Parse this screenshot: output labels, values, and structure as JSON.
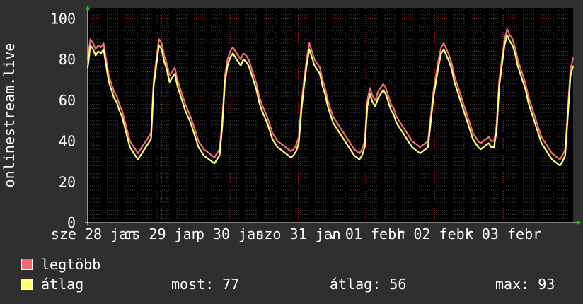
{
  "chart_data": {
    "type": "line",
    "ylabel": "onlinestream.live",
    "ylim": [
      0,
      105
    ],
    "yticks": [
      0,
      20,
      40,
      60,
      80,
      100
    ],
    "grid": true,
    "xtick_labels": [
      "sze 28 jan",
      "cs 29 jan",
      "p 30 jan",
      "szo 31 jan",
      "v 01 febr",
      "h 02 febr",
      "k 03 febr"
    ],
    "series": [
      {
        "name": "legtöbb",
        "color": "#f06a78",
        "values": [
          80,
          90,
          88,
          85,
          87,
          86,
          88,
          80,
          72,
          68,
          64,
          62,
          58,
          55,
          50,
          45,
          40,
          38,
          36,
          34,
          36,
          38,
          40,
          42,
          44,
          70,
          80,
          90,
          88,
          82,
          78,
          72,
          74,
          76,
          70,
          66,
          62,
          58,
          55,
          52,
          48,
          44,
          40,
          38,
          36,
          35,
          34,
          33,
          32,
          34,
          36,
          50,
          72,
          80,
          84,
          86,
          84,
          82,
          80,
          83,
          82,
          80,
          76,
          72,
          68,
          62,
          58,
          55,
          52,
          48,
          44,
          42,
          40,
          39,
          38,
          37,
          36,
          35,
          36,
          38,
          42,
          58,
          70,
          80,
          88,
          84,
          80,
          78,
          76,
          70,
          66,
          60,
          56,
          52,
          50,
          48,
          46,
          44,
          42,
          40,
          38,
          36,
          35,
          34,
          36,
          40,
          60,
          66,
          62,
          60,
          64,
          66,
          68,
          66,
          62,
          58,
          56,
          52,
          50,
          48,
          46,
          44,
          42,
          40,
          39,
          38,
          37,
          38,
          39,
          40,
          52,
          64,
          72,
          80,
          86,
          88,
          85,
          82,
          78,
          72,
          68,
          64,
          60,
          56,
          52,
          48,
          44,
          42,
          40,
          39,
          40,
          41,
          42,
          40,
          40,
          48,
          70,
          80,
          90,
          95,
          92,
          90,
          86,
          80,
          76,
          72,
          68,
          62,
          58,
          54,
          50,
          46,
          42,
          40,
          38,
          36,
          34,
          33,
          32,
          31,
          33,
          36,
          55,
          75,
          81
        ]
      },
      {
        "name": "átlag",
        "color": "#ffff70",
        "values": [
          76,
          87,
          85,
          82,
          84,
          83,
          85,
          77,
          69,
          65,
          61,
          59,
          55,
          52,
          47,
          42,
          37,
          35,
          33,
          31,
          33,
          35,
          37,
          39,
          41,
          67,
          77,
          87,
          85,
          79,
          75,
          69,
          71,
          73,
          67,
          63,
          59,
          55,
          52,
          49,
          45,
          41,
          37,
          35,
          33,
          32,
          31,
          30,
          29,
          31,
          33,
          47,
          69,
          77,
          81,
          83,
          81,
          79,
          77,
          80,
          79,
          77,
          73,
          69,
          65,
          59,
          55,
          52,
          49,
          45,
          41,
          39,
          37,
          36,
          35,
          34,
          33,
          32,
          33,
          35,
          39,
          55,
          67,
          77,
          85,
          81,
          77,
          75,
          73,
          67,
          63,
          57,
          53,
          49,
          47,
          45,
          43,
          41,
          39,
          37,
          35,
          33,
          32,
          31,
          33,
          37,
          57,
          63,
          59,
          57,
          61,
          63,
          65,
          63,
          59,
          55,
          53,
          49,
          47,
          45,
          43,
          41,
          39,
          37,
          36,
          35,
          34,
          35,
          36,
          37,
          49,
          61,
          69,
          77,
          83,
          85,
          82,
          79,
          75,
          69,
          65,
          61,
          57,
          53,
          49,
          45,
          41,
          39,
          37,
          36,
          37,
          38,
          39,
          37,
          37,
          45,
          67,
          77,
          87,
          92,
          89,
          87,
          83,
          77,
          73,
          69,
          65,
          59,
          55,
          51,
          47,
          43,
          39,
          37,
          35,
          33,
          31,
          30,
          29,
          28,
          30,
          33,
          52,
          72,
          77
        ]
      }
    ],
    "legend": [
      {
        "label": "legtöbb",
        "color": "#f06a78"
      },
      {
        "label": "átlag",
        "color": "#ffff70"
      }
    ],
    "legend_position": "bottom-left",
    "stats": {
      "most": "most: 77",
      "atlag": "átlag: 56",
      "max": "max: 93"
    }
  }
}
